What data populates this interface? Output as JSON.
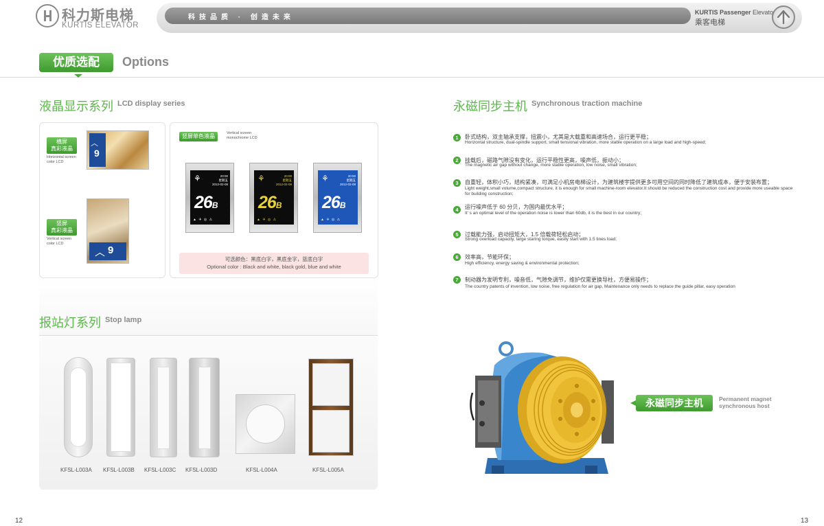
{
  "header": {
    "logo_cn": "科力斯电梯",
    "logo_en": "KURTIS ELEVATOR",
    "slogan": "科技品质 · 创造未来",
    "brand_en_bold": "KURTIS Passenger",
    "brand_en_rest": " Elevator",
    "brand_cn": "乘客电梯"
  },
  "section": {
    "title_cn": "优质选配",
    "title_en": "Options"
  },
  "lcd": {
    "title_cn": "液晶显示系列",
    "title_en": "LCD display series",
    "horizontal_tag": "横屏\n真彩液晶",
    "horizontal_en": "Horizontal screen\ncolor LCD",
    "vertical_tag": "竖屏\n真彩液晶",
    "vertical_en": "Vertical screen\ncolor LCD",
    "mono_tag": "竖屏单色液晶",
    "mono_en": "Vertical screen\nmonochrome LCD",
    "floor_small": "9",
    "floor_big": "26",
    "floor_suffix": "B",
    "color_note_cn": "可选颜色：黑底白字，黑底金字，蓝底白字",
    "color_note_en": "Optional color : Black and white, black gold, blue and white",
    "mono_colors": [
      {
        "bg": "#0c0c0c",
        "fg": "#ffffff"
      },
      {
        "bg": "#0c0c0c",
        "fg": "#e8d23a"
      },
      {
        "bg": "#1f57b8",
        "fg": "#ffffff"
      }
    ]
  },
  "lamps": {
    "title_cn": "报站灯系列",
    "title_en": "Stop lamp",
    "items": [
      {
        "label": "KFSL-L003A"
      },
      {
        "label": "KFSL-L003B"
      },
      {
        "label": "KFSL-L003C"
      },
      {
        "label": "KFSL-L003D"
      },
      {
        "label": "KFSL-L004A"
      },
      {
        "label": "KFSL-L005A"
      }
    ]
  },
  "machine": {
    "title_cn": "永磁同步主机",
    "title_en": "Synchronous traction machine",
    "features": [
      {
        "num": "1",
        "cn": "卧式结构，双主轴承支撑，扭震小，尤其是大载重和高速场合，运行更平稳；",
        "en": "Horizontal structure, dual-spindle support, small tensional vibration, more stable operation on a large load and high-speed;"
      },
      {
        "num": "2",
        "cn": "挂载后，磁路气隙没有变化，运行平稳性更高，噪声低，振动小；",
        "en": "The magnetic air gap without change, more stable operation, low noise, small vibration;"
      },
      {
        "num": "3",
        "cn": "自重轻，体积小巧，结构紧凑，可满足小机房电梯设计，为建筑楼宇提供更多可用空间的同时降低了建筑成本，便于安装布置；",
        "en": "Light weight,small volume,compact structure, it is enough for small machine-room elevator.It should be reduced the construction cost and provide more useable space for building construction;"
      },
      {
        "num": "4",
        "cn": "运行噪声低于 60 分贝，为国内最优水平；",
        "en": "It' s an optimal level of the operation noise is lower than 60db, it is the best in our country;"
      },
      {
        "num": "5",
        "cn": "过载能力强，启动扭矩大，1.5 倍载荷轻松启动；",
        "en": "Strong overload capacity, large staring torque, easily start with 1.5 tines load;"
      },
      {
        "num": "6",
        "cn": "效率高，节能环保；",
        "en": "High efficiency, energy saving & environmental protection;"
      },
      {
        "num": "7",
        "cn": "制动器为发明专利，噪音低，气隙免调节，维护仅需更换导柱，方便易操作；",
        "en": "The country patents of invention, low noise, free regulation for air gap, Maintenance only needs to replace the guide pillar, easy operation"
      }
    ],
    "host_cn": "永磁同步主机",
    "host_en": "Permanent magnet\nsynchronous host"
  },
  "pages": {
    "left": "12",
    "right": "13"
  }
}
